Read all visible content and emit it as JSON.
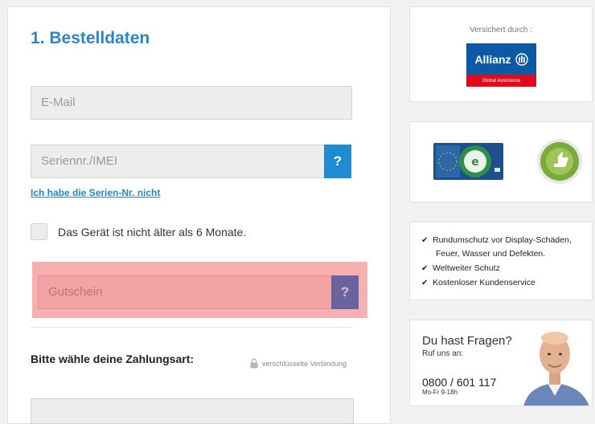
{
  "order": {
    "title": "1. Bestelldaten",
    "email_placeholder": "E-Mail",
    "serial_placeholder": "Seriennr./IMEI",
    "help_label": "?",
    "no_serial_link": "Ich habe die Serien-Nr. nicht",
    "device_age_label": "Das Gerät ist nicht älter als 6 Monate.",
    "coupon_placeholder": "Gutschein",
    "payment_label": "Bitte wähle deine Zahlungsart:",
    "secure_label": "verschlüsselte Verbindung"
  },
  "insurance": {
    "label": "Versichert durch :",
    "brand": "Allianz",
    "sub": "Global Assistance"
  },
  "badges": {
    "eu_label": "Euro-Label",
    "ekomi_label": "eKomi"
  },
  "features": [
    {
      "icon": "check-icon",
      "line1": "Rundumschutz vor Display-Schäden,",
      "line2": "Feuer, Wasser und Defekten."
    },
    {
      "icon": "check-icon",
      "line1": "Weltweiter Schutz"
    },
    {
      "icon": "check-icon",
      "line1": "Kostenloser Kundenservice"
    }
  ],
  "contact": {
    "title": "Du hast Fragen?",
    "sub": "Ruf uns an:",
    "phone": "0800 / 601 117",
    "hours": "Mo-Fr 9-18h"
  },
  "colors": {
    "accent_blue": "#2a86c8",
    "help_button": "#1f8bd3",
    "highlight": "#f7b0b0",
    "coupon_help": "#6b62a0",
    "allianz_blue": "#0c5aa6",
    "allianz_red": "#e10a1a"
  }
}
